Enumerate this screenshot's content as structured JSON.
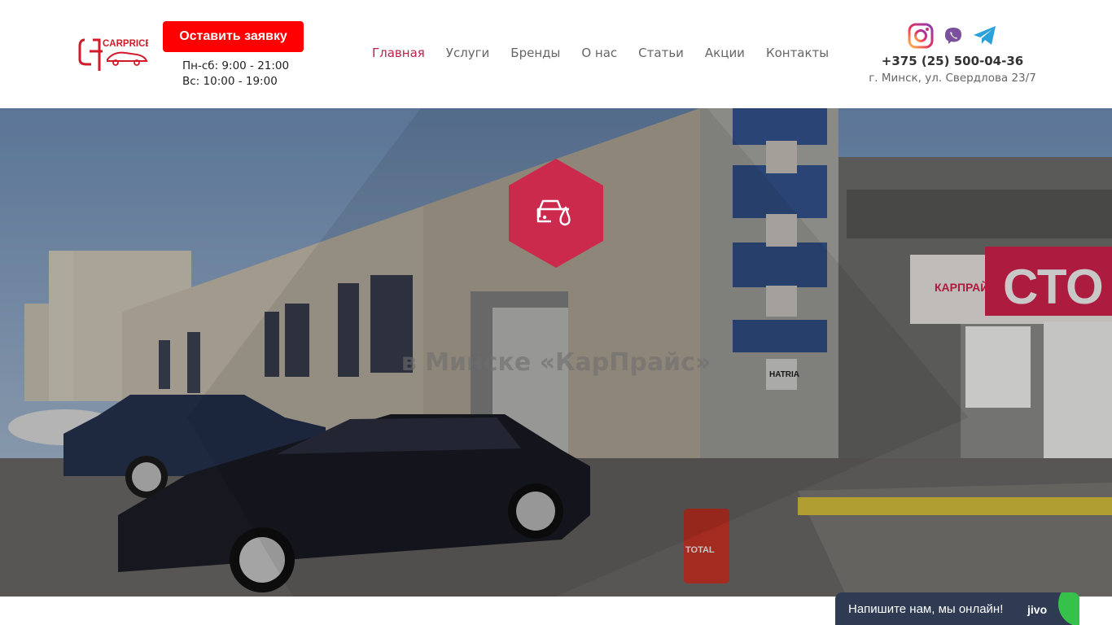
{
  "header": {
    "logo_text": "CARPRICE",
    "cta_label": "Оставить заявку",
    "hours": [
      "Пн-сб: 9:00 - 21:00",
      "Вс: 10:00 - 19:00"
    ],
    "phone": "+375 (25) 500-04-36",
    "address": "г. Минск, ул. Свердлова 23/7"
  },
  "nav": {
    "items": [
      {
        "label": "Главная",
        "active": true
      },
      {
        "label": "Услуги"
      },
      {
        "label": "Бренды"
      },
      {
        "label": "О нас"
      },
      {
        "label": "Статьи"
      },
      {
        "label": "Акции"
      },
      {
        "label": "Контакты"
      }
    ]
  },
  "socials": [
    "instagram-icon",
    "viber-icon",
    "telegram-icon"
  ],
  "hero": {
    "title": "в Минске «КарПрайс»",
    "badge_icon": "car-oil-drop-icon",
    "sign_texts": [
      "КАРПРАЙС",
      "СТО",
      "HATRIA",
      "TOTAL"
    ]
  },
  "chat": {
    "text": "Напишите нам, мы онлайн!",
    "brand": "jivo"
  },
  "colors": {
    "accent": "#c21e4a",
    "cta": "#ff0000",
    "chat_bg": "#2e3b53",
    "chat_dot": "#36c24a"
  }
}
